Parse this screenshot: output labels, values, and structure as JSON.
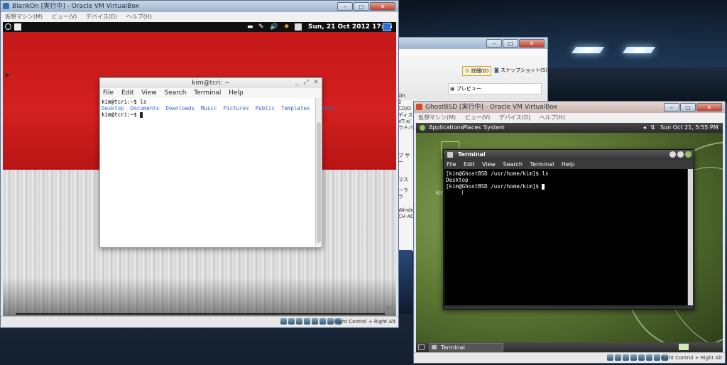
{
  "host": {
    "colors": {
      "accent": "#2b5fa8"
    }
  },
  "vm_blankon": {
    "title": "BlankOn [実行中] - Oracle VM VirtualBox",
    "menu": [
      "仮想マシン(M)",
      "ビュー(V)",
      "デバイス(D)",
      "ヘルプ(H)"
    ],
    "panel_clock": "Sun, 21 Oct 2012 17:55",
    "terminal": {
      "title": "kim@tcri: ~",
      "menu": [
        "File",
        "Edit",
        "View",
        "Search",
        "Terminal",
        "Help"
      ],
      "line1": "kim@tcri:~$ ls",
      "dirs": [
        "Desktop",
        "Documents",
        "Downloads",
        "Music",
        "Pictures",
        "Public",
        "Templates",
        "Videos"
      ],
      "line3": "kim@tcri:~$ "
    },
    "wallpaper_corner": "bl",
    "host_key": "Right Control + Right Alt"
  },
  "vm_manager": {
    "details_button": "詳細(D)",
    "snapshot_button": "スナップショット(S)",
    "preview_label": "プレビュー",
    "fragments": [
      "On",
      "2",
      "CD/D",
      "ディス",
      "VT-x/",
      "ラドバ",
      "プ サー",
      "マス",
      "ーラ",
      "ラ",
      "Window",
      "CH AC"
    ]
  },
  "vm_ghostbsd": {
    "title": "GhostBSD [実行中] - Oracle VM VirtualBox",
    "menu": [
      "仮想マシン(M)",
      "ビュー(V)",
      "デバイス(D)",
      "ヘルプ(H)"
    ],
    "panel_menu": [
      "Applications",
      "Places",
      "System"
    ],
    "panel_clock": "Sun Oct 21,  5:55 PM",
    "desktop_label": "kim",
    "terminal": {
      "title": "Terminal",
      "menu": [
        "File",
        "Edit",
        "View",
        "Search",
        "Terminal",
        "Help"
      ],
      "line1": "[kim@GhostBSD /usr/home/kim]$ ls",
      "line2": "Desktop",
      "line3": "[kim@GhostBSD /usr/home/kim]$ "
    },
    "taskbar_item": "Terminal",
    "host_key": "Right Control + Right Alt"
  }
}
